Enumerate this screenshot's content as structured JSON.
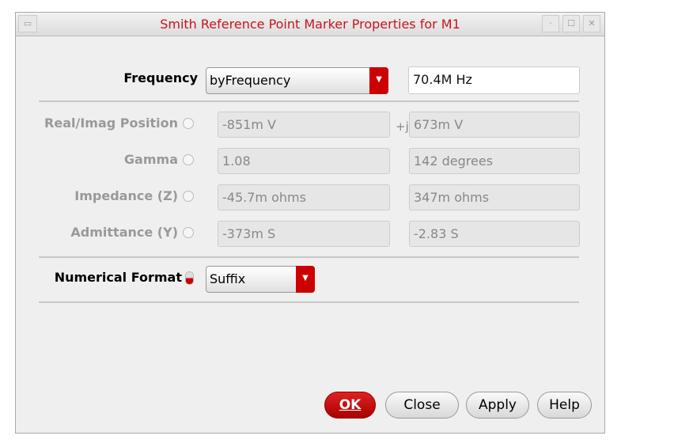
{
  "title": "Smith Reference Point Marker Properties for M1",
  "frequency": {
    "label": "Frequency",
    "mode": "byFrequency",
    "value": "70.4M Hz"
  },
  "rows": [
    {
      "label": "Real/Imag Position",
      "v1": "-851m V",
      "sep": "+j",
      "v2": "673m V"
    },
    {
      "label": "Gamma",
      "v1": "1.08",
      "sep": "",
      "v2": "142 degrees"
    },
    {
      "label": "Impedance (Z)",
      "v1": "-45.7m ohms",
      "sep": "",
      "v2": "347m ohms"
    },
    {
      "label": "Admittance (Y)",
      "v1": "-373m S",
      "sep": "",
      "v2": "-2.83 S"
    }
  ],
  "format": {
    "label": "Numerical Format",
    "value": "Suffix"
  },
  "buttons": {
    "ok": "OK",
    "close": "Close",
    "apply": "Apply",
    "help": "Help"
  }
}
